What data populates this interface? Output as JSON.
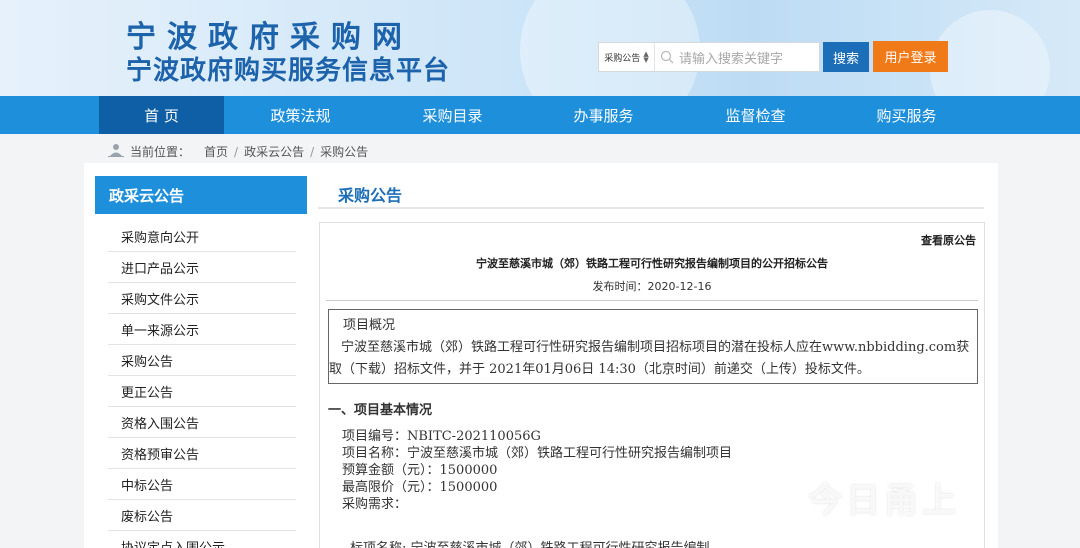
{
  "header": {
    "title": "宁波政府采购网",
    "subtitle": "宁波政府购买服务信息平台",
    "search_scope": "采购公告",
    "search_placeholder": "请输入搜索关键字",
    "search_button": "搜索",
    "login_button": "用户登录",
    "accent_color": "#1c63ab",
    "login_color": "#f07a18"
  },
  "nav": {
    "items": [
      "首 页",
      "政策法规",
      "采购目录",
      "办事服务",
      "监督检查",
      "购买服务"
    ],
    "active_index": 0
  },
  "breadcrumb": {
    "label": "当前位置：",
    "items": [
      "首页",
      "政采云公告",
      "采购公告"
    ],
    "separator": "/"
  },
  "sidebar": {
    "title": "政采云公告",
    "items": [
      "采购意向公开",
      "进口产品公示",
      "采购文件公示",
      "单一来源公示",
      "采购公告",
      "更正公告",
      "资格入围公告",
      "资格预审公告",
      "中标公告",
      "废标公告",
      "协议定点入围公示"
    ]
  },
  "content": {
    "section_title": "采购公告",
    "view_original": "查看原公告",
    "doc_title": "宁波至慈溪市城（郊）铁路工程可行性研究报告编制项目的公开招标公告",
    "publish_time": "发布时间：2020-12-16",
    "overview_heading": "项目概况",
    "overview_line1": "宁波至慈溪市城（郊）铁路工程可行性研究报告编制项目招标项目的潜在投标人应在www.nbbidding.com获",
    "overview_line2": "取（下载）招标文件，并于 2021年01月06日 14:30（北京时间）前递交（上传）投标文件。",
    "section1_heading": "一、项目基本情况",
    "info_lines": [
      "项目编号：NBITC-202110056G",
      "项目名称：宁波至慈溪市城（郊）铁路工程可行性研究报告编制项目",
      "预算金额（元）：1500000",
      "最高限价（元）：1500000",
      "采购需求："
    ],
    "lot_line": "标项名称: 宁波至慈溪市城（郊）铁路工程可行性研究报告编制"
  },
  "watermark": "今日甬上"
}
